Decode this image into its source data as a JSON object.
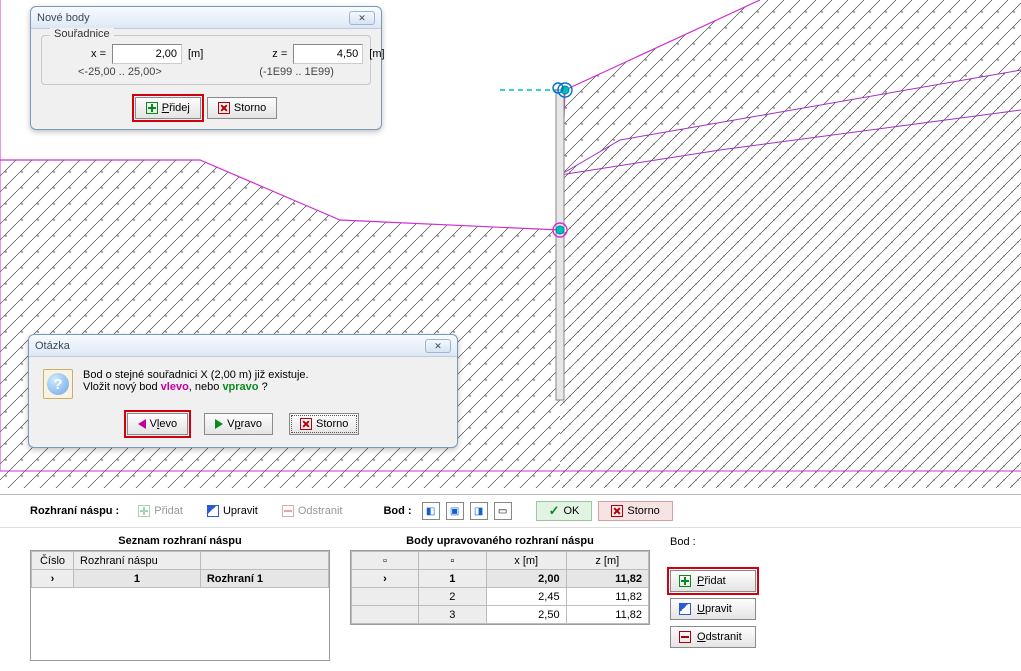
{
  "dialog_points": {
    "title": "Nové body",
    "fieldset": "Souřadnice",
    "x_label": "x  =",
    "z_label": "z  =",
    "unit": "[m]",
    "x_value": "2,00",
    "z_value": "4,50",
    "x_hint": "<-25,00 .. 25,00>",
    "z_hint": "(-1E99 .. 1E99)",
    "btn_add": "Přidej",
    "btn_cancel": "Storno"
  },
  "dialog_question": {
    "title": "Otázka",
    "line1": "Bod o stejné souřadnici X (2,00 m) již existuje.",
    "line2a": "Vložit nový bod ",
    "kw_left": "vlevo",
    "line2b": ", nebo ",
    "kw_right": "vpravo",
    "line2c": " ?",
    "btn_left": "Vlevo",
    "btn_right": "Vpravo",
    "btn_cancel": "Storno"
  },
  "toolbar": {
    "title": "Rozhraní náspu :",
    "add": "Přidat",
    "edit": "Upravit",
    "remove": "Odstranit",
    "bod": "Bod :",
    "ok": "OK",
    "cancel": "Storno"
  },
  "left_table": {
    "title": "Seznam rozhraní náspu",
    "col1": "Číslo",
    "col2": "Rozhraní náspu",
    "rows": [
      {
        "num": "1",
        "name": "Rozhraní 1"
      }
    ]
  },
  "right_table": {
    "title": "Body upravovaného rozhraní náspu",
    "col_x": "x [m]",
    "col_z": "z [m]",
    "rows": [
      {
        "n": "1",
        "x": "2,00",
        "z": "11,82"
      },
      {
        "n": "2",
        "x": "2,45",
        "z": "11,82"
      },
      {
        "n": "3",
        "x": "2,50",
        "z": "11,82"
      }
    ]
  },
  "side": {
    "label": "Bod :",
    "add": "Přidat",
    "edit": "Upravit",
    "remove": "Odstranit"
  }
}
